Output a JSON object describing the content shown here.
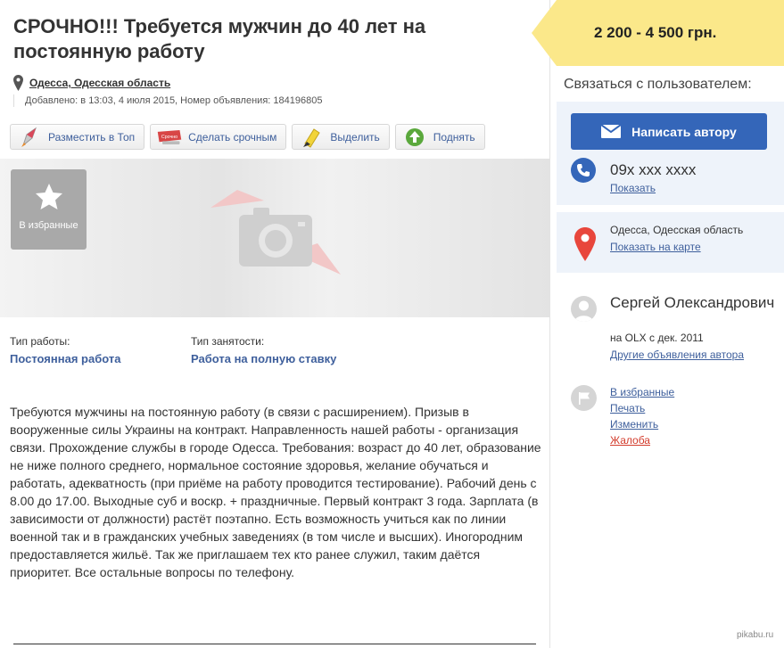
{
  "ad": {
    "title": "СРОЧНО!!! Требуется мужчин до 40 лет на постоянную работу",
    "location": "Одесса, Одесская область",
    "added": "Добавлено: в 13:03, 4 июля 2015, Номер объявления: 184196805",
    "price": "2 200 - 4 500 грн."
  },
  "actions": [
    {
      "label": "Разместить в Топ",
      "icon": "rocket-icon"
    },
    {
      "label": "Сделать срочным",
      "icon": "urgent-label-icon",
      "icon_text": "Срочно"
    },
    {
      "label": "Выделить",
      "icon": "highlighter-icon"
    },
    {
      "label": "Поднять",
      "icon": "lift-up-icon"
    }
  ],
  "photo": {
    "favorite_label": "В избранные",
    "placeholder_icon": "camera-icon"
  },
  "params": [
    {
      "label": "Тип работы:",
      "value": "Постоянная работа"
    },
    {
      "label": "Тип занятости:",
      "value": "Работа на полную ставку"
    }
  ],
  "description": "Требуются мужчины на постоянную работу (в связи с расширением). Призыв в вооруженные силы Украины на контракт. Направленность нашей работы - организация связи. Прохождение службы в городе Одесса. Требования: возраст до 40 лет, образование не ниже полного среднего, нормальное состояние здоровья, желание обучаться и работать, адекватность (при приёме на работу проводится тестирование). Рабочий день с 8.00 до 17.00. Выходные суб и воскр. + праздничные. Первый контракт 3 года. Зарплата (в зависимости от должности) растёт поэтапно. Есть возможность учиться как по линии военной так и в гражданских учебных заведениях (в том числе и высших). Иногородним предоставляется жильё. Так же приглашаем тех кто ранее служил, таким даётся приоритет. Все остальные вопросы по телефону.",
  "sidebar": {
    "contact_heading": "Связаться с пользователем:",
    "write_button": "Написать автору",
    "phone": "09x xxx xxxx",
    "show_phone": "Показать",
    "map_city": "Одесса, Одесская область",
    "map_link": "Показать на карте",
    "user_name": "Сергей Олександрович",
    "user_since": "на OLX с дек. 2011",
    "user_other_ads": "Другие объявления автора",
    "links": {
      "favorites": "В избранные",
      "print": "Печать",
      "edit": "Изменить",
      "complaint": "Жалоба"
    }
  },
  "colors": {
    "accent_blue": "#3466b9",
    "link_blue": "#3e5f9c",
    "price_yellow": "#fbe88a",
    "complaint_red": "#d33c2c",
    "sidebar_box": "#eef3fa"
  },
  "watermark": "pikabu.ru"
}
